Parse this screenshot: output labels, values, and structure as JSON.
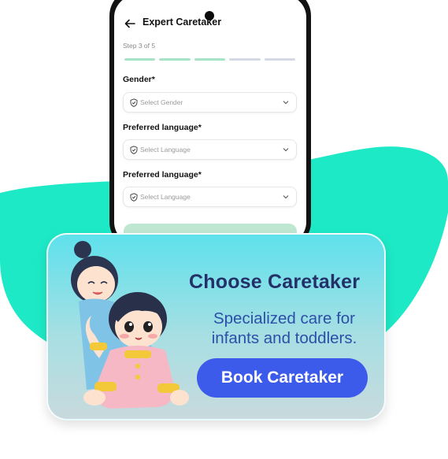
{
  "app": {
    "title": "Expert Caretaker",
    "step_text": "Step 3 of 5",
    "progress": {
      "current": 3,
      "total": 5
    }
  },
  "form": {
    "fields": [
      {
        "label": "Gender*",
        "placeholder": "Select Gender"
      },
      {
        "label": "Preferred language*",
        "placeholder": "Select Language"
      },
      {
        "label": "Preferred language*",
        "placeholder": "Select Language"
      }
    ]
  },
  "promo": {
    "title": "Choose Caretaker",
    "subtitle_line1": "Specialized care for",
    "subtitle_line2": "infants and toddlers.",
    "cta_label": "Book Caretaker"
  },
  "colors": {
    "teal_blob": "#1de9c6",
    "card_top": "#5ee1ec",
    "title": "#243068",
    "subtitle": "#2c4fa8",
    "cta": "#3c5bea",
    "progress_done": "#a9e3c6",
    "progress_todo": "#d5d9e6"
  },
  "icons": [
    "back-arrow-icon",
    "shield-check-icon",
    "chevron-down-icon"
  ]
}
